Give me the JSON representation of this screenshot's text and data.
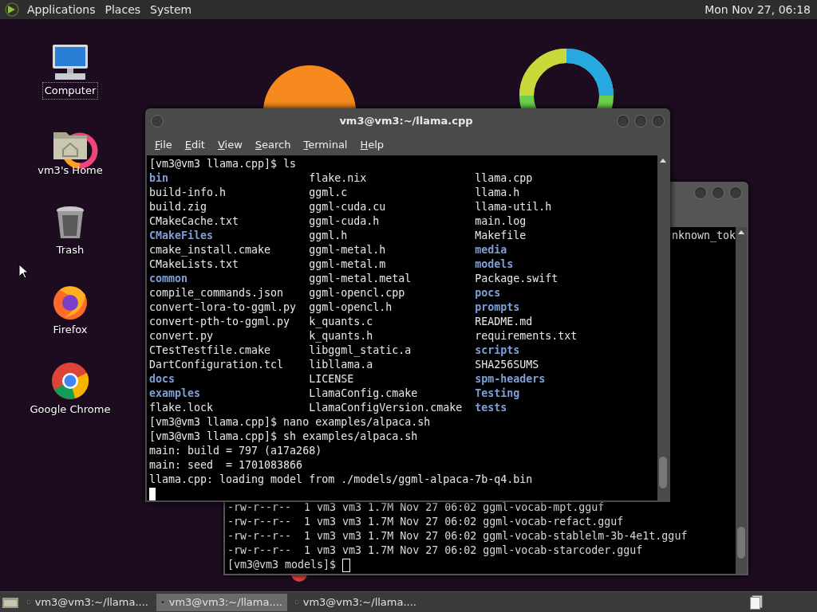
{
  "top_panel": {
    "menus": [
      "Applications",
      "Places",
      "System"
    ],
    "clock": "Mon Nov 27, 06:18"
  },
  "desktop_icons": [
    {
      "kind": "computer",
      "label": "Computer",
      "selected": true
    },
    {
      "kind": "home",
      "label": "vm3's Home",
      "selected": false
    },
    {
      "kind": "trash",
      "label": "Trash",
      "selected": false
    },
    {
      "kind": "firefox",
      "label": "Firefox",
      "selected": false
    },
    {
      "kind": "chrome",
      "label": "Google Chrome",
      "selected": false
    }
  ],
  "back_terminal": {
    "top_line": "nknown_tok",
    "lines": [
      "-rw-r--r--  1 vm3 vm3 1.7M Nov 27 06:02 ggml-vocab-mpt.gguf",
      "-rw-r--r--  1 vm3 vm3 1.7M Nov 27 06:02 ggml-vocab-refact.gguf",
      "-rw-r--r--  1 vm3 vm3 1.7M Nov 27 06:02 ggml-vocab-stablelm-3b-4e1t.gguf",
      "-rw-r--r--  1 vm3 vm3 1.7M Nov 27 06:02 ggml-vocab-starcoder.gguf",
      "[vm3@vm3 models]$ "
    ]
  },
  "front_terminal": {
    "title": "vm3@vm3:~/llama.cpp",
    "menu": [
      "File",
      "Edit",
      "View",
      "Search",
      "Terminal",
      "Help"
    ],
    "command": "[vm3@vm3 llama.cpp]$ ls",
    "listing": [
      [
        {
          "name": "bin",
          "kind": "dir"
        },
        {
          "name": "build-info.h",
          "kind": "file"
        },
        {
          "name": "build.zig",
          "kind": "file"
        },
        {
          "name": "CMakeCache.txt",
          "kind": "file"
        },
        {
          "name": "CMakeFiles",
          "kind": "dir"
        },
        {
          "name": "cmake_install.cmake",
          "kind": "file"
        },
        {
          "name": "CMakeLists.txt",
          "kind": "file"
        },
        {
          "name": "common",
          "kind": "dir"
        },
        {
          "name": "compile_commands.json",
          "kind": "file"
        },
        {
          "name": "convert-lora-to-ggml.py",
          "kind": "file"
        },
        {
          "name": "convert-pth-to-ggml.py",
          "kind": "file"
        },
        {
          "name": "convert.py",
          "kind": "file"
        },
        {
          "name": "CTestTestfile.cmake",
          "kind": "file"
        },
        {
          "name": "DartConfiguration.tcl",
          "kind": "file"
        },
        {
          "name": "docs",
          "kind": "dir"
        },
        {
          "name": "examples",
          "kind": "dir"
        },
        {
          "name": "flake.lock",
          "kind": "file"
        }
      ],
      [
        {
          "name": "flake.nix",
          "kind": "file"
        },
        {
          "name": "ggml.c",
          "kind": "file"
        },
        {
          "name": "ggml-cuda.cu",
          "kind": "file"
        },
        {
          "name": "ggml-cuda.h",
          "kind": "file"
        },
        {
          "name": "ggml.h",
          "kind": "file"
        },
        {
          "name": "ggml-metal.h",
          "kind": "file"
        },
        {
          "name": "ggml-metal.m",
          "kind": "file"
        },
        {
          "name": "ggml-metal.metal",
          "kind": "file"
        },
        {
          "name": "ggml-opencl.cpp",
          "kind": "file"
        },
        {
          "name": "ggml-opencl.h",
          "kind": "file"
        },
        {
          "name": "k_quants.c",
          "kind": "file"
        },
        {
          "name": "k_quants.h",
          "kind": "file"
        },
        {
          "name": "libggml_static.a",
          "kind": "file"
        },
        {
          "name": "libllama.a",
          "kind": "file"
        },
        {
          "name": "LICENSE",
          "kind": "file"
        },
        {
          "name": "LlamaConfig.cmake",
          "kind": "file"
        },
        {
          "name": "LlamaConfigVersion.cmake",
          "kind": "file"
        }
      ],
      [
        {
          "name": "llama.cpp",
          "kind": "file"
        },
        {
          "name": "llama.h",
          "kind": "file"
        },
        {
          "name": "llama-util.h",
          "kind": "file"
        },
        {
          "name": "main.log",
          "kind": "file"
        },
        {
          "name": "Makefile",
          "kind": "file"
        },
        {
          "name": "media",
          "kind": "dir"
        },
        {
          "name": "models",
          "kind": "dir"
        },
        {
          "name": "Package.swift",
          "kind": "file"
        },
        {
          "name": "pocs",
          "kind": "dir"
        },
        {
          "name": "prompts",
          "kind": "dir"
        },
        {
          "name": "README.md",
          "kind": "file"
        },
        {
          "name": "requirements.txt",
          "kind": "file"
        },
        {
          "name": "scripts",
          "kind": "dir"
        },
        {
          "name": "SHA256SUMS",
          "kind": "file"
        },
        {
          "name": "spm-headers",
          "kind": "dir"
        },
        {
          "name": "Testing",
          "kind": "dir"
        },
        {
          "name": "tests",
          "kind": "dir"
        }
      ]
    ],
    "output": [
      "[vm3@vm3 llama.cpp]$ nano examples/alpaca.sh",
      "[vm3@vm3 llama.cpp]$ sh examples/alpaca.sh",
      "main: build = 797 (a17a268)",
      "main: seed  = 1701083866",
      "llama.cpp: loading model from ./models/ggml-alpaca-7b-q4.bin"
    ]
  },
  "taskbar": [
    {
      "label": "vm3@vm3:~/llama....",
      "selected": false
    },
    {
      "label": "vm3@vm3:~/llama....",
      "selected": true
    },
    {
      "label": "vm3@vm3:~/llama....",
      "selected": false
    }
  ]
}
